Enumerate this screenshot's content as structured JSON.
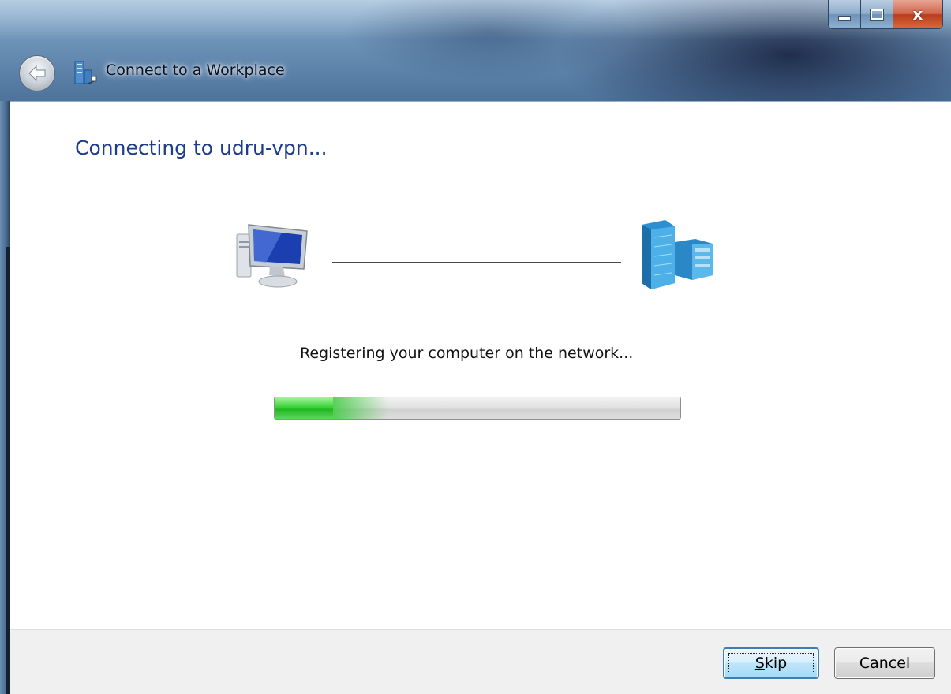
{
  "window": {
    "title": "Connect to a Workplace",
    "caption_buttons": {
      "minimize_icon": "minimize-icon",
      "maximize_icon": "maximize-icon",
      "close_glyph": "x"
    }
  },
  "header": {
    "back_icon": "back-arrow-icon",
    "app_icon": "workplace-network-icon"
  },
  "main": {
    "heading": "Connecting to udru-vpn...",
    "diagram": {
      "left_icon": "computer-icon",
      "right_icon": "corporate-server-icon"
    },
    "status_text": "Registering your computer on the network...",
    "progress": {
      "value_fraction": 0.28,
      "color": "#2ed02e"
    }
  },
  "footer": {
    "skip_mnemonic": "S",
    "skip_rest": "kip",
    "cancel_label": "Cancel"
  },
  "colors": {
    "heading": "#1e3c8c",
    "focus_button_border": "#3c7fb1",
    "close_button": "#c8502e"
  }
}
